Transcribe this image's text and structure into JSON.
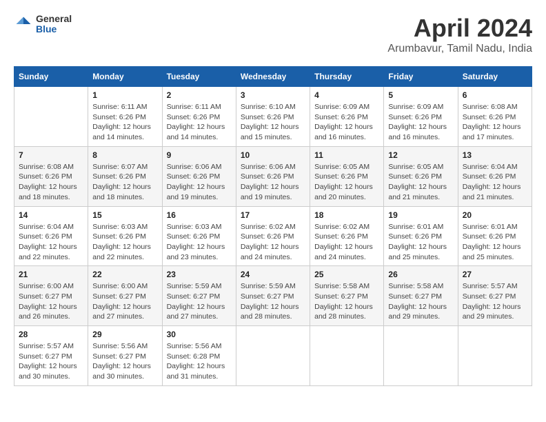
{
  "logo": {
    "general": "General",
    "blue": "Blue"
  },
  "header": {
    "title": "April 2024",
    "subtitle": "Arumbavur, Tamil Nadu, India"
  },
  "weekdays": [
    "Sunday",
    "Monday",
    "Tuesday",
    "Wednesday",
    "Thursday",
    "Friday",
    "Saturday"
  ],
  "weeks": [
    [
      {
        "day": "",
        "info": ""
      },
      {
        "day": "1",
        "info": "Sunrise: 6:11 AM\nSunset: 6:26 PM\nDaylight: 12 hours\nand 14 minutes."
      },
      {
        "day": "2",
        "info": "Sunrise: 6:11 AM\nSunset: 6:26 PM\nDaylight: 12 hours\nand 14 minutes."
      },
      {
        "day": "3",
        "info": "Sunrise: 6:10 AM\nSunset: 6:26 PM\nDaylight: 12 hours\nand 15 minutes."
      },
      {
        "day": "4",
        "info": "Sunrise: 6:09 AM\nSunset: 6:26 PM\nDaylight: 12 hours\nand 16 minutes."
      },
      {
        "day": "5",
        "info": "Sunrise: 6:09 AM\nSunset: 6:26 PM\nDaylight: 12 hours\nand 16 minutes."
      },
      {
        "day": "6",
        "info": "Sunrise: 6:08 AM\nSunset: 6:26 PM\nDaylight: 12 hours\nand 17 minutes."
      }
    ],
    [
      {
        "day": "7",
        "info": "Sunrise: 6:08 AM\nSunset: 6:26 PM\nDaylight: 12 hours\nand 18 minutes."
      },
      {
        "day": "8",
        "info": "Sunrise: 6:07 AM\nSunset: 6:26 PM\nDaylight: 12 hours\nand 18 minutes."
      },
      {
        "day": "9",
        "info": "Sunrise: 6:06 AM\nSunset: 6:26 PM\nDaylight: 12 hours\nand 19 minutes."
      },
      {
        "day": "10",
        "info": "Sunrise: 6:06 AM\nSunset: 6:26 PM\nDaylight: 12 hours\nand 19 minutes."
      },
      {
        "day": "11",
        "info": "Sunrise: 6:05 AM\nSunset: 6:26 PM\nDaylight: 12 hours\nand 20 minutes."
      },
      {
        "day": "12",
        "info": "Sunrise: 6:05 AM\nSunset: 6:26 PM\nDaylight: 12 hours\nand 21 minutes."
      },
      {
        "day": "13",
        "info": "Sunrise: 6:04 AM\nSunset: 6:26 PM\nDaylight: 12 hours\nand 21 minutes."
      }
    ],
    [
      {
        "day": "14",
        "info": "Sunrise: 6:04 AM\nSunset: 6:26 PM\nDaylight: 12 hours\nand 22 minutes."
      },
      {
        "day": "15",
        "info": "Sunrise: 6:03 AM\nSunset: 6:26 PM\nDaylight: 12 hours\nand 22 minutes."
      },
      {
        "day": "16",
        "info": "Sunrise: 6:03 AM\nSunset: 6:26 PM\nDaylight: 12 hours\nand 23 minutes."
      },
      {
        "day": "17",
        "info": "Sunrise: 6:02 AM\nSunset: 6:26 PM\nDaylight: 12 hours\nand 24 minutes."
      },
      {
        "day": "18",
        "info": "Sunrise: 6:02 AM\nSunset: 6:26 PM\nDaylight: 12 hours\nand 24 minutes."
      },
      {
        "day": "19",
        "info": "Sunrise: 6:01 AM\nSunset: 6:26 PM\nDaylight: 12 hours\nand 25 minutes."
      },
      {
        "day": "20",
        "info": "Sunrise: 6:01 AM\nSunset: 6:26 PM\nDaylight: 12 hours\nand 25 minutes."
      }
    ],
    [
      {
        "day": "21",
        "info": "Sunrise: 6:00 AM\nSunset: 6:27 PM\nDaylight: 12 hours\nand 26 minutes."
      },
      {
        "day": "22",
        "info": "Sunrise: 6:00 AM\nSunset: 6:27 PM\nDaylight: 12 hours\nand 27 minutes."
      },
      {
        "day": "23",
        "info": "Sunrise: 5:59 AM\nSunset: 6:27 PM\nDaylight: 12 hours\nand 27 minutes."
      },
      {
        "day": "24",
        "info": "Sunrise: 5:59 AM\nSunset: 6:27 PM\nDaylight: 12 hours\nand 28 minutes."
      },
      {
        "day": "25",
        "info": "Sunrise: 5:58 AM\nSunset: 6:27 PM\nDaylight: 12 hours\nand 28 minutes."
      },
      {
        "day": "26",
        "info": "Sunrise: 5:58 AM\nSunset: 6:27 PM\nDaylight: 12 hours\nand 29 minutes."
      },
      {
        "day": "27",
        "info": "Sunrise: 5:57 AM\nSunset: 6:27 PM\nDaylight: 12 hours\nand 29 minutes."
      }
    ],
    [
      {
        "day": "28",
        "info": "Sunrise: 5:57 AM\nSunset: 6:27 PM\nDaylight: 12 hours\nand 30 minutes."
      },
      {
        "day": "29",
        "info": "Sunrise: 5:56 AM\nSunset: 6:27 PM\nDaylight: 12 hours\nand 30 minutes."
      },
      {
        "day": "30",
        "info": "Sunrise: 5:56 AM\nSunset: 6:28 PM\nDaylight: 12 hours\nand 31 minutes."
      },
      {
        "day": "",
        "info": ""
      },
      {
        "day": "",
        "info": ""
      },
      {
        "day": "",
        "info": ""
      },
      {
        "day": "",
        "info": ""
      }
    ]
  ]
}
